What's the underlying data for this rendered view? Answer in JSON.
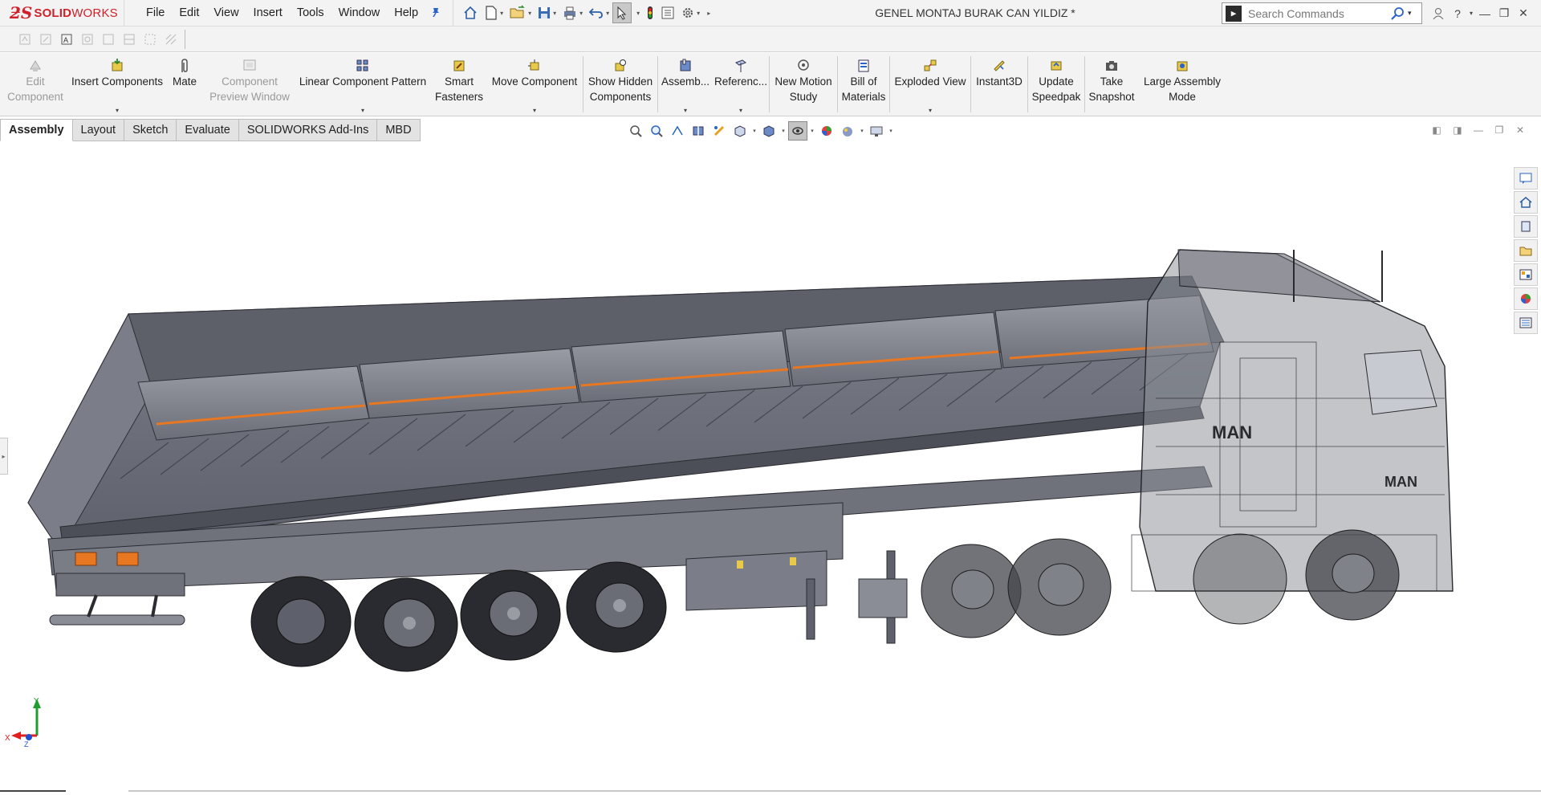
{
  "app": {
    "logo_mark": "ƻS",
    "logo_text_bold": "SOLID",
    "logo_text_rest": "WORKS",
    "document_title": "GENEL MONTAJ BURAK CAN YILDIZ *"
  },
  "menu": [
    "File",
    "Edit",
    "View",
    "Insert",
    "Tools",
    "Window",
    "Help"
  ],
  "search": {
    "placeholder": "Search Commands"
  },
  "command_manager": {
    "edit_component": "Edit Component",
    "insert_components": "Insert Components",
    "mate": "Mate",
    "component_preview": "Component Preview Window",
    "linear_pattern": "Linear Component Pattern",
    "smart_fasteners": "Smart Fasteners",
    "move_component": "Move Component",
    "show_hidden": "Show Hidden Components",
    "assembly_features": "Assemb...",
    "reference_geometry": "Referenc...",
    "new_motion": "New Motion Study",
    "bom": "Bill of Materials",
    "exploded_view": "Exploded View",
    "instant3d": "Instant3D",
    "update_speedpak": "Update Speedpak",
    "take_snapshot": "Take Snapshot",
    "large_assembly": "Large Assembly Mode"
  },
  "tabs": [
    "Assembly",
    "Layout",
    "Sketch",
    "Evaluate",
    "SOLIDWORKS Add-Ins",
    "MBD"
  ],
  "triad": {
    "y": "Y",
    "x": "X",
    "z": "Z"
  },
  "model_labels": {
    "cab_brand": "MAN",
    "grille_brand": "MAN"
  },
  "colors": {
    "accent": "#d0202a",
    "body_gray": "#6b6e78",
    "stripe_orange": "#e87722",
    "triad_x": "#e02020",
    "triad_y": "#1f9d2e",
    "triad_z": "#2050d0"
  }
}
